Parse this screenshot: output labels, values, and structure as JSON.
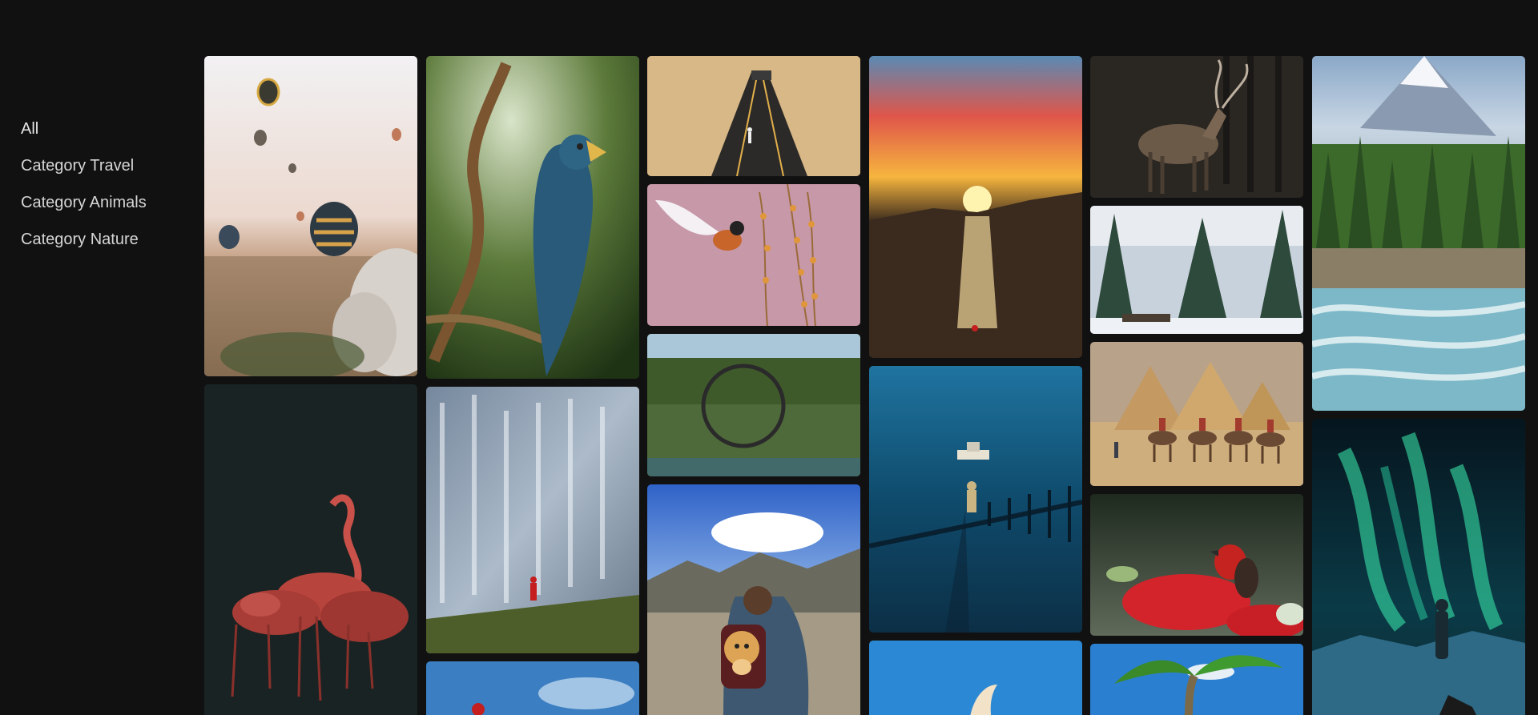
{
  "sidebar": {
    "items": [
      {
        "label": "All",
        "active": true
      },
      {
        "label": "Category Travel",
        "active": false
      },
      {
        "label": "Category Animals",
        "active": false
      },
      {
        "label": "Category Nature",
        "active": false
      }
    ]
  },
  "gallery": {
    "columns": [
      [
        {
          "subject": "hot air balloons over rock valley",
          "category": "Travel"
        },
        {
          "subject": "flamingos on dark background",
          "category": "Animals"
        }
      ],
      [
        {
          "subject": "blue parrot on branch",
          "category": "Animals"
        },
        {
          "subject": "waterfall with hiker",
          "category": "Nature"
        },
        {
          "subject": "hiker under blue sky",
          "category": "Travel"
        }
      ],
      [
        {
          "subject": "road through desert",
          "category": "Travel"
        },
        {
          "subject": "bird in flight near flowers",
          "category": "Animals"
        },
        {
          "subject": "arched bridge reflection",
          "category": "Nature"
        },
        {
          "subject": "hiker carrying dog in backpack",
          "category": "Travel"
        }
      ],
      [
        {
          "subject": "sunset over waterfall canyon",
          "category": "Nature"
        },
        {
          "subject": "person on pier at dusk",
          "category": "Travel"
        },
        {
          "subject": "bird wing against blue sky",
          "category": "Animals"
        }
      ],
      [
        {
          "subject": "deer in dark forest",
          "category": "Animals"
        },
        {
          "subject": "snowy pine trees",
          "category": "Nature"
        },
        {
          "subject": "camels by the pyramids",
          "category": "Travel"
        },
        {
          "subject": "red bird on red flower",
          "category": "Animals"
        },
        {
          "subject": "palm tree",
          "category": "Travel"
        }
      ],
      [
        {
          "subject": "mountain river and pine forest",
          "category": "Nature"
        },
        {
          "subject": "aurora borealis with person on rock",
          "category": "Nature"
        }
      ]
    ]
  }
}
